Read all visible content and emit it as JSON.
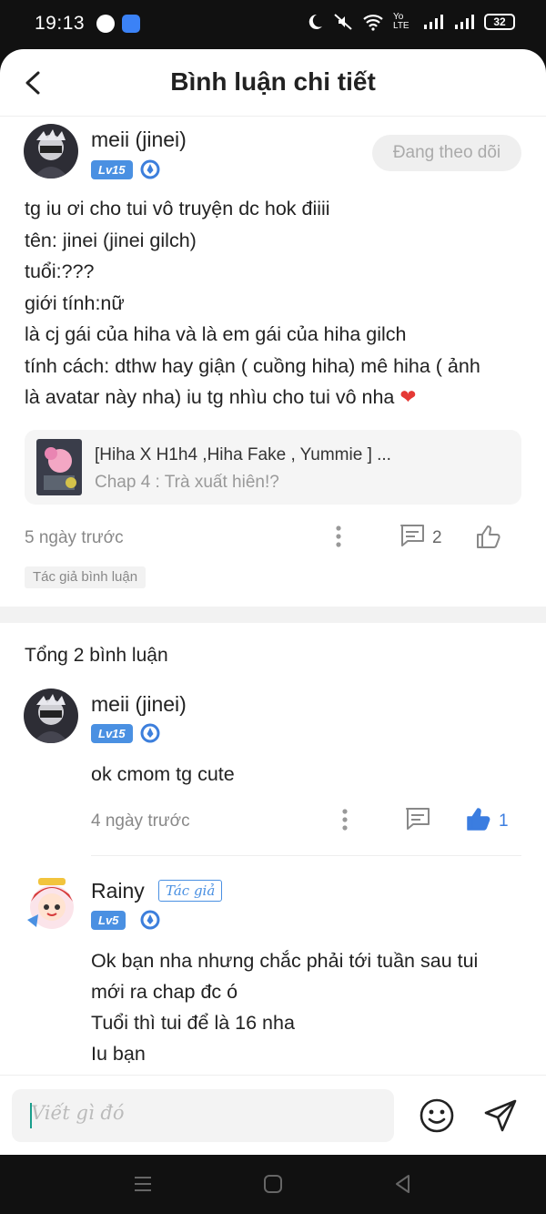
{
  "status_bar": {
    "time": "19:13",
    "battery": "32",
    "network": "Yo LTE"
  },
  "header": {
    "title": "Bình luận chi tiết",
    "back_icon": "back-arrow-icon"
  },
  "main_comment": {
    "author": "meii (jinei)",
    "level": "Lv15",
    "follow_label": "Đang theo dõi",
    "lines": [
      "tg iu ơi cho tui vô truyện dc hok điiii",
      "tên: jinei (jinei gilch)",
      "tuổi:???",
      "giới tính:nữ",
      "là cj gái của hiha và là em gái của hiha gilch",
      "tính cách: dthw hay giận ( cuồng hiha) mê hiha ( ảnh",
      "là avatar này nha) iu tg nhìu cho tui vô nha"
    ],
    "heart": "❤",
    "story": {
      "title": "[Hiha X H1h4 ,Hiha Fake , Yummie ] ...",
      "chapter": "Chap 4 : Trà xuất hiên!?"
    },
    "time": "5 ngày trước",
    "reply_count": "2",
    "tag": "Tác giả bình luận"
  },
  "replies_section": {
    "total_label": "Tổng 2 bình luận"
  },
  "replies": [
    {
      "author": "meii (jinei)",
      "level": "Lv15",
      "text": "ok cmom tg cute",
      "time": "4 ngày trước",
      "like_count": "1"
    },
    {
      "author": "Rainy",
      "author_tag": "Tác giả",
      "level": "Lv5",
      "lines": [
        "Ok bạn nha nhưng chắc phải tới tuần sau tui",
        "mới ra chap đc ó",
        "Tuổi thì tui để là 16 nha",
        "Iu bạn"
      ]
    }
  ],
  "input_bar": {
    "placeholder": "Viết gì đó"
  },
  "colors": {
    "accent_blue": "#4a90e2",
    "heart_red": "#e53935",
    "caret_teal": "#1a9e8c"
  }
}
